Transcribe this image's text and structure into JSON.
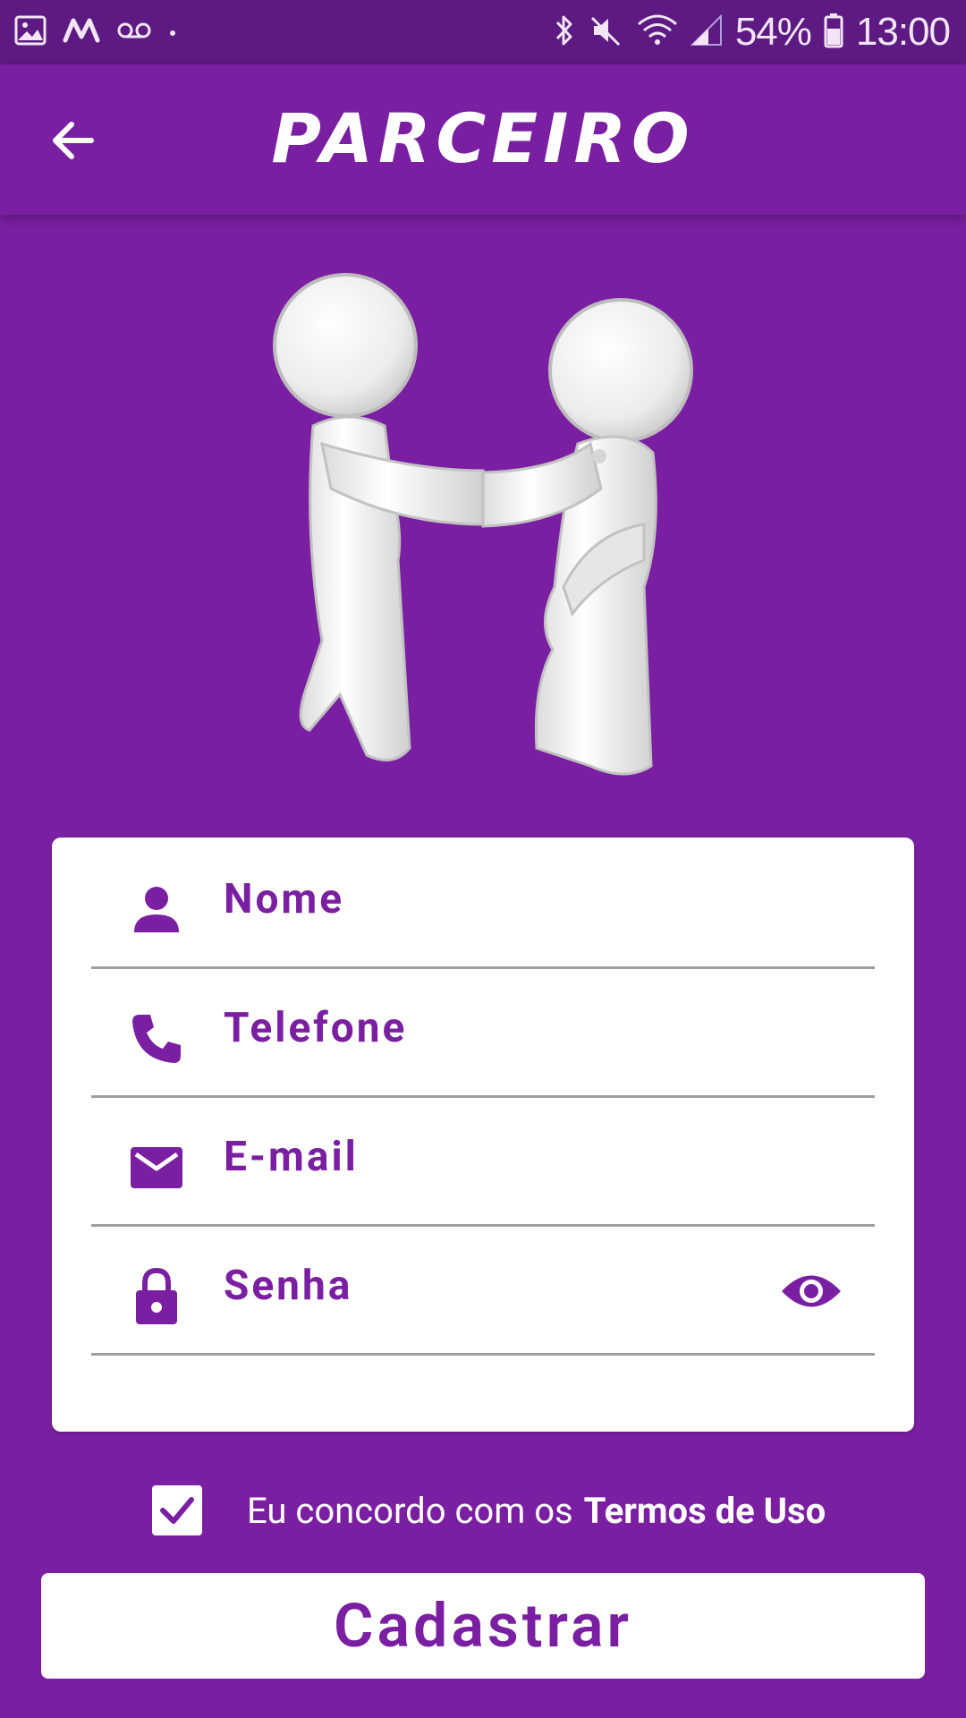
{
  "status_bar": {
    "battery": "54%",
    "time": "13:00",
    "icons_left": [
      "image-icon",
      "app-m-icon",
      "voicemail-icon",
      "dot-icon"
    ],
    "icons_right": [
      "bluetooth-icon",
      "mute-icon",
      "wifi-icon",
      "signal-icon",
      "battery-icon"
    ]
  },
  "app_bar": {
    "title": "PARCEIRO",
    "back_icon": "arrow-left-icon"
  },
  "illustration": {
    "icon": "handshake-figures-illustration"
  },
  "form": {
    "fields": [
      {
        "icon": "person-icon",
        "label": "Nome"
      },
      {
        "icon": "phone-icon",
        "label": "Telefone"
      },
      {
        "icon": "email-icon",
        "label": "E-mail"
      },
      {
        "icon": "lock-icon",
        "label": "Senha",
        "action_icon": "eye-icon"
      }
    ]
  },
  "terms": {
    "checked": true,
    "text": "Eu concordo com os",
    "link": "Termos de Uso"
  },
  "submit": {
    "label": "Cadastrar"
  },
  "colors": {
    "primary": "#7b1fa2",
    "status_bar": "#5c1a82",
    "surface": "#ffffff",
    "divider": "#9e9e9e"
  }
}
